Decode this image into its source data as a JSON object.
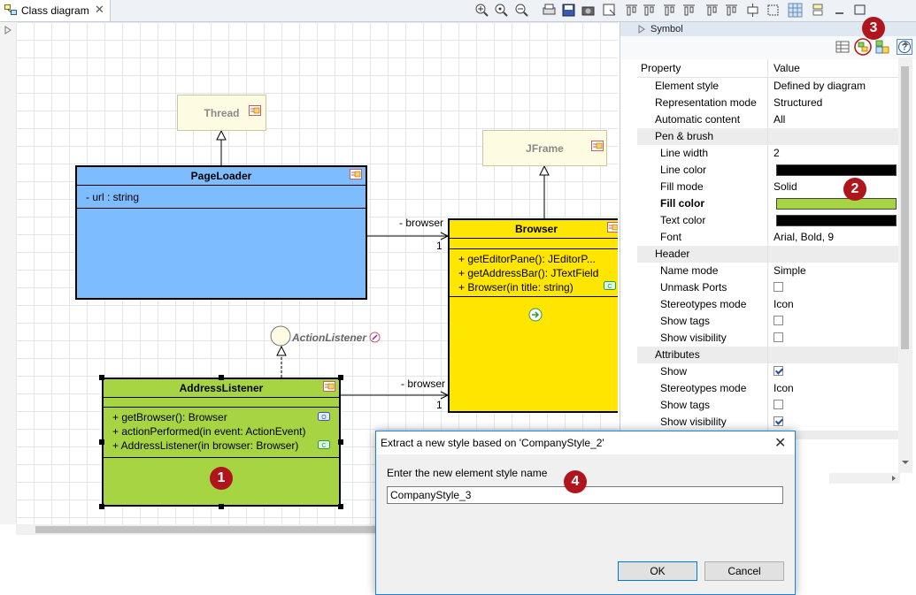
{
  "tab": {
    "title": "Class diagram"
  },
  "toolbar_icons": [
    "zoom-in-icon",
    "zoom-fit-icon",
    "zoom-out-icon",
    "print-icon",
    "save-icon",
    "camera-icon",
    "export-icon",
    "align-top-icon",
    "align-middle-icon",
    "align-bottom-icon",
    "align-left-icon",
    "align-center-icon",
    "align-right-icon",
    "distribute-icon",
    "resize-icon",
    "grid-icon",
    "layers-icon",
    "minimize-icon",
    "maximize-icon"
  ],
  "diagram": {
    "thread": {
      "name": "Thread"
    },
    "jframe": {
      "name": "JFrame"
    },
    "pageloader": {
      "name": "PageLoader",
      "attributes": [
        "- url : string"
      ]
    },
    "browser": {
      "name": "Browser",
      "methods": [
        "+ getEditorPane(): JEditorP...",
        "+ getAddressBar(): JTextField",
        "+ Browser(in title: string)"
      ]
    },
    "actionlistener": {
      "name": "ActionListener"
    },
    "addresslistener": {
      "name": "AddressListener",
      "methods": [
        "+ getBrowser(): Browser",
        "+ actionPerformed(in event: ActionEvent)",
        "+ AddressListener(in browser: Browser)"
      ]
    },
    "assoc1": {
      "role": "- browser",
      "mult": "1"
    },
    "assoc2": {
      "role": "- browser",
      "mult": "1"
    },
    "colors": {
      "blue": "#7dbcff",
      "yellow": "#ffe600",
      "green": "#a6d443",
      "ghost": "#fdfbe1"
    }
  },
  "badges": {
    "b1": "1",
    "b2": "2",
    "b3": "3",
    "b4": "4"
  },
  "panel": {
    "symbol_label": "Symbol",
    "header": {
      "property": "Property",
      "value": "Value"
    },
    "rows": [
      {
        "type": "prop",
        "key": "Element style",
        "value": "Defined by diagram",
        "indent": 1
      },
      {
        "type": "prop",
        "key": "Representation mode",
        "value": "Structured",
        "indent": 1
      },
      {
        "type": "prop",
        "key": "Automatic content",
        "value": "All",
        "indent": 1
      },
      {
        "type": "section",
        "key": "Pen & brush"
      },
      {
        "type": "prop",
        "key": "Line width",
        "value": "2",
        "indent": 2
      },
      {
        "type": "color",
        "key": "Line color",
        "color": "#000000",
        "indent": 2
      },
      {
        "type": "prop",
        "key": "Fill mode",
        "value": "Solid",
        "indent": 2
      },
      {
        "type": "color",
        "key": "Fill color",
        "color": "#a6d443",
        "indent": 2,
        "bold": true
      },
      {
        "type": "color",
        "key": "Text color",
        "color": "#000000",
        "indent": 2
      },
      {
        "type": "prop",
        "key": "Font",
        "value": "Arial, Bold, 9",
        "indent": 2
      },
      {
        "type": "section",
        "key": "Header"
      },
      {
        "type": "prop",
        "key": "Name mode",
        "value": "Simple",
        "indent": 2
      },
      {
        "type": "check",
        "key": "Unmask Ports",
        "checked": false,
        "indent": 2
      },
      {
        "type": "prop",
        "key": "Stereotypes mode",
        "value": "Icon",
        "indent": 2
      },
      {
        "type": "check",
        "key": "Show tags",
        "checked": false,
        "indent": 2
      },
      {
        "type": "check",
        "key": "Show visibility",
        "checked": false,
        "indent": 2
      },
      {
        "type": "section",
        "key": "Attributes"
      },
      {
        "type": "check",
        "key": "Show",
        "checked": true,
        "indent": 2
      },
      {
        "type": "prop",
        "key": "Stereotypes mode",
        "value": "Icon",
        "indent": 2
      },
      {
        "type": "check",
        "key": "Show tags",
        "checked": false,
        "indent": 2
      },
      {
        "type": "check",
        "key": "Show visibility",
        "checked": true,
        "indent": 2
      }
    ]
  },
  "dialog": {
    "title": "Extract a new style based on 'CompanyStyle_2'",
    "prompt": "Enter the new element style name",
    "value": "CompanyStyle_3",
    "ok": "OK",
    "cancel": "Cancel"
  }
}
